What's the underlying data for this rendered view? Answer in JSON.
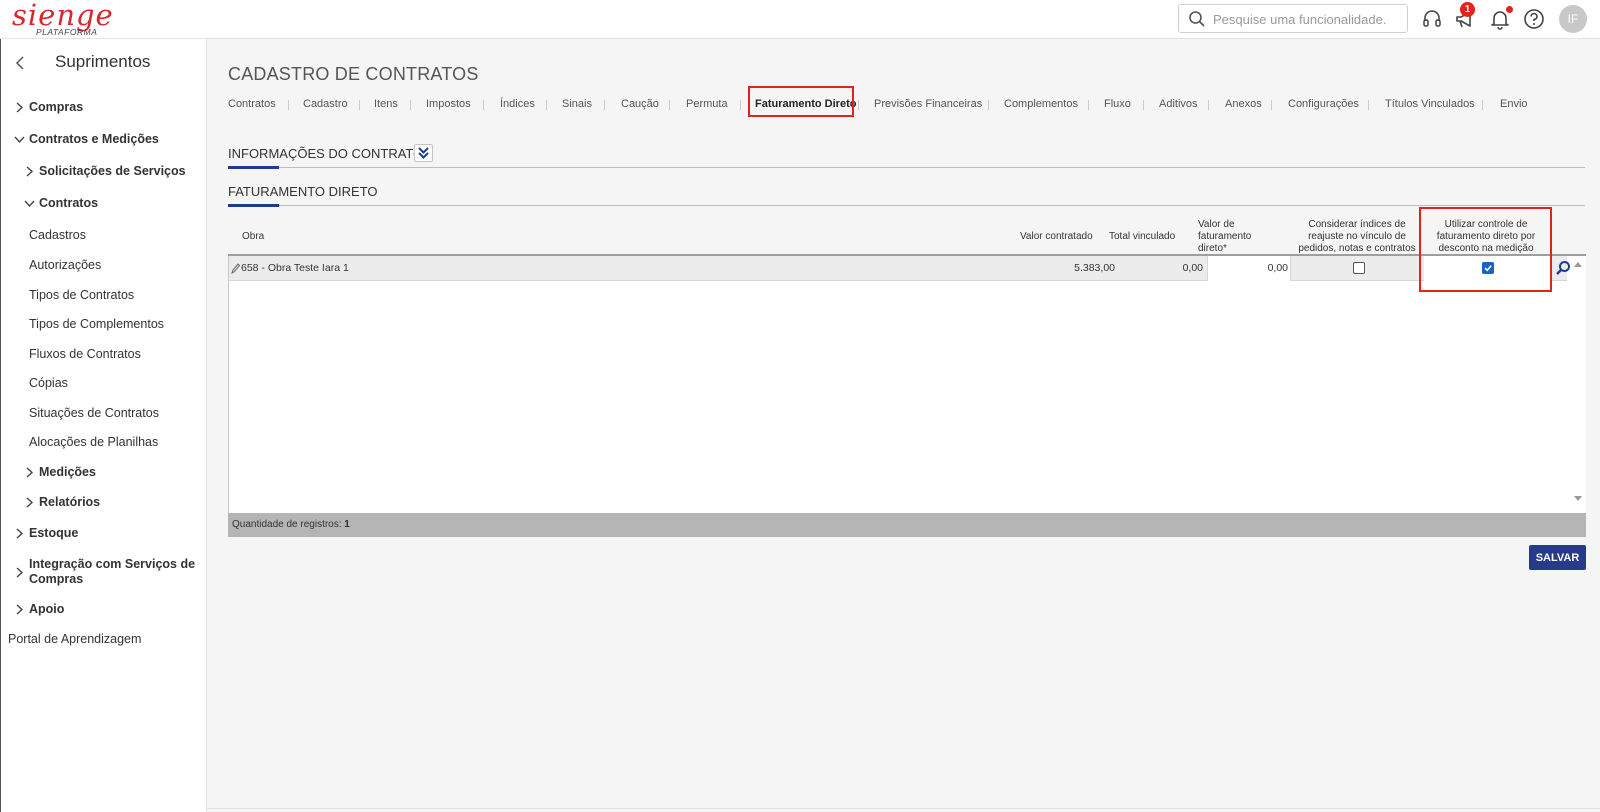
{
  "header": {
    "logo_text": "sienge",
    "logo_sub": "PLATAFORMA",
    "search_placeholder": "Pesquise uma funcionalidade.",
    "notification_count": "1",
    "avatar_initials": "IF"
  },
  "sidebar": {
    "title": "Suprimentos",
    "items": [
      {
        "label": "Compras"
      },
      {
        "label": "Contratos e Medições"
      },
      {
        "label": "Solicitações de Serviços"
      },
      {
        "label": "Contratos"
      },
      {
        "label": "Cadastros"
      },
      {
        "label": "Autorizações"
      },
      {
        "label": "Tipos de Contratos"
      },
      {
        "label": "Tipos de Complementos"
      },
      {
        "label": "Fluxos de Contratos"
      },
      {
        "label": "Cópias"
      },
      {
        "label": "Situações de Contratos"
      },
      {
        "label": "Alocações de Planilhas"
      },
      {
        "label": "Medições"
      },
      {
        "label": "Relatórios"
      },
      {
        "label": "Estoque"
      },
      {
        "label": "Integração com Serviços de"
      },
      {
        "label": "Compras"
      },
      {
        "label": "Apoio"
      },
      {
        "label": "Portal de Aprendizagem"
      }
    ]
  },
  "main": {
    "page_title": "CADASTRO DE CONTRATOS",
    "tabs": [
      {
        "label": "Contratos"
      },
      {
        "label": "Cadastro"
      },
      {
        "label": "Itens"
      },
      {
        "label": "Impostos"
      },
      {
        "label": "Índices"
      },
      {
        "label": "Sinais"
      },
      {
        "label": "Caução"
      },
      {
        "label": "Permuta"
      },
      {
        "label": "Faturamento Direto"
      },
      {
        "label": "Previsões Financeiras"
      },
      {
        "label": "Complementos"
      },
      {
        "label": "Fluxo"
      },
      {
        "label": "Aditivos"
      },
      {
        "label": "Anexos"
      },
      {
        "label": "Configurações"
      },
      {
        "label": "Títulos Vinculados"
      },
      {
        "label": "Envio"
      }
    ],
    "section_info": "INFORMAÇÕES DO CONTRATO",
    "section_fat": "FATURAMENTO DIRETO",
    "table": {
      "headers": {
        "obra": "Obra",
        "valor_contratado": "Valor contratado",
        "total_vinculado": "Total vinculado",
        "valor_fat_1": "Valor de",
        "valor_fat_2": "faturamento",
        "valor_fat_3": "direto*",
        "considerar_1": "Considerar índices de",
        "considerar_2": "reajuste no vínculo de",
        "considerar_3": "pedidos, notas e contratos",
        "utilizar_1": "Utilizar controle de",
        "utilizar_2": "faturamento direto por",
        "utilizar_3": "desconto na medição"
      },
      "rows": [
        {
          "obra": "658 - Obra Teste Iara 1",
          "valor_contratado": "5.383,00",
          "total_vinculado": "0,00",
          "valor_fat": "0,00",
          "considerar_checked": false,
          "utilizar_checked": true
        }
      ],
      "footer_label": "Quantidade de registros:",
      "footer_count": "1"
    },
    "save_label": "SALVAR"
  }
}
